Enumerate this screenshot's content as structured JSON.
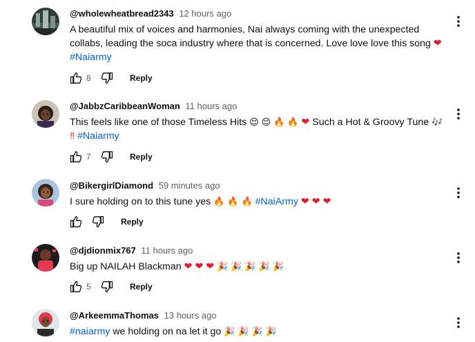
{
  "comments": [
    {
      "author": "@wholewheatbread2343",
      "time": "12 hours ago",
      "line1": "A beautiful mix of voices and harmonies, Nai always coming with the unexpected",
      "line2": "collabs, leading the soca industry where that is concerned. Love love love this song",
      "hashtag": "#Naiarmy",
      "likes": "8",
      "reply": "Reply"
    },
    {
      "author": "@JabbzCaribbeanWoman",
      "time": "11 hours ago",
      "line1a": "This feels like one of those Timeless Hits",
      "line1b": "Such a Hot & Groovy Tune",
      "hashtag": "#Naiarmy",
      "likes": "7",
      "reply": "Reply"
    },
    {
      "author": "@BikergirlDiamond",
      "time": "59 minutes ago",
      "line1a": "I sure holding on to this tune yes",
      "hashtag": "#NaiArmy",
      "likes": "",
      "reply": "Reply"
    },
    {
      "author": "@djdionmix767",
      "time": "11 hours ago",
      "line1a": "Big up NAILAH Blackman",
      "likes": "5",
      "reply": "Reply"
    },
    {
      "author": "@ArkeemmaThomas",
      "time": "13 hours ago",
      "hashtag": "#naiarmy",
      "line1b": "we holding on na let it go",
      "likes": "",
      "reply": "Reply"
    }
  ],
  "emoji": {
    "heart": "❤",
    "fire": "🔥",
    "relieved": "😌",
    "notes": "🎶",
    "bangbang": "‼",
    "party": "🎉"
  },
  "colors": {
    "hashtag": "#065fd4",
    "heart": "#e21b2a",
    "text": "#0f0f0f",
    "muted": "#606060"
  }
}
